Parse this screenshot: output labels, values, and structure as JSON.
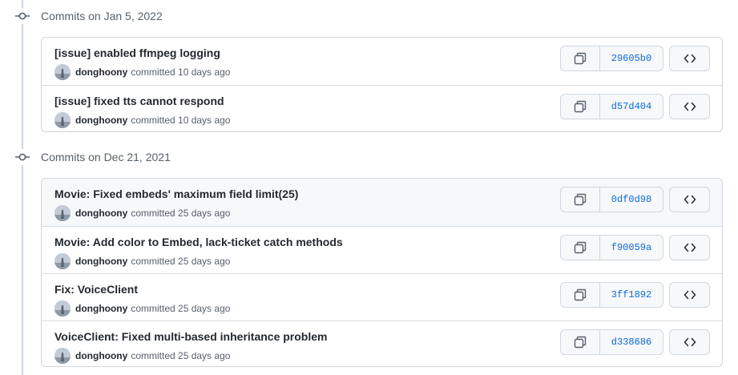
{
  "groups": [
    {
      "title": "Commits on Jan 5, 2022",
      "commits": [
        {
          "message": "[issue] enabled ffmpeg logging",
          "author": "donghoony",
          "action": "committed",
          "time": "10 days ago",
          "sha": "29605b0"
        },
        {
          "message": "[issue] fixed tts cannot respond",
          "author": "donghoony",
          "action": "committed",
          "time": "10 days ago",
          "sha": "d57d404"
        }
      ]
    },
    {
      "title": "Commits on Dec 21, 2021",
      "commits": [
        {
          "message": "Movie: Fixed embeds' maximum field limit(25)",
          "author": "donghoony",
          "action": "committed",
          "time": "25 days ago",
          "sha": "0df0d98"
        },
        {
          "message": "Movie: Add color to Embed, lack-ticket catch methods",
          "author": "donghoony",
          "action": "committed",
          "time": "25 days ago",
          "sha": "f90059a"
        },
        {
          "message": "Fix: VoiceClient",
          "author": "donghoony",
          "action": "committed",
          "time": "25 days ago",
          "sha": "3ff1892"
        },
        {
          "message": "VoiceClient: Fixed multi-based inheritance problem",
          "author": "donghoony",
          "action": "committed",
          "time": "25 days ago",
          "sha": "d338686"
        }
      ]
    }
  ],
  "icons": {
    "group": "git-commit-icon",
    "copy": "copy-icon",
    "browse": "code-icon"
  },
  "colors": {
    "sha_link": "#0969da",
    "border": "#d0d7de",
    "hover_row": "#f6f8fa"
  }
}
